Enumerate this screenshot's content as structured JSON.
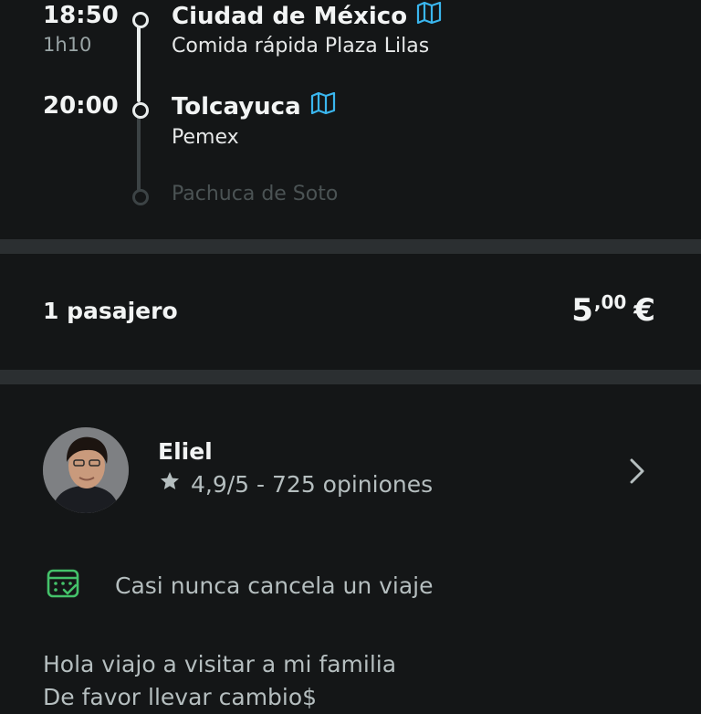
{
  "route": {
    "stops": [
      {
        "time": "18:50",
        "duration": "1h10",
        "city": "Ciudad de México",
        "place": "Comida rápida Plaza Lilas"
      },
      {
        "time": "20:00",
        "city": "Tolcayuca",
        "place": "Pemex"
      }
    ],
    "final_destination": "Pachuca de Soto"
  },
  "booking": {
    "passengers": "1 pasajero",
    "price_int": "5",
    "price_dec": ",00",
    "currency": "€"
  },
  "driver": {
    "name": "Eliel",
    "rating": "4,9/5 - 725 opiniones",
    "badge": "Casi nunca cancela un viaje",
    "bio_line1": "Hola viajo a visitar a mi familia",
    "bio_line2": "De favor llevar cambio$"
  },
  "colors": {
    "background": "#141617",
    "divider": "#2b2f31",
    "map_icon": "#3ab6ee",
    "badge_icon": "#44c26a",
    "text_primary": "#f2f4f4",
    "text_secondary": "#b5bebf"
  }
}
